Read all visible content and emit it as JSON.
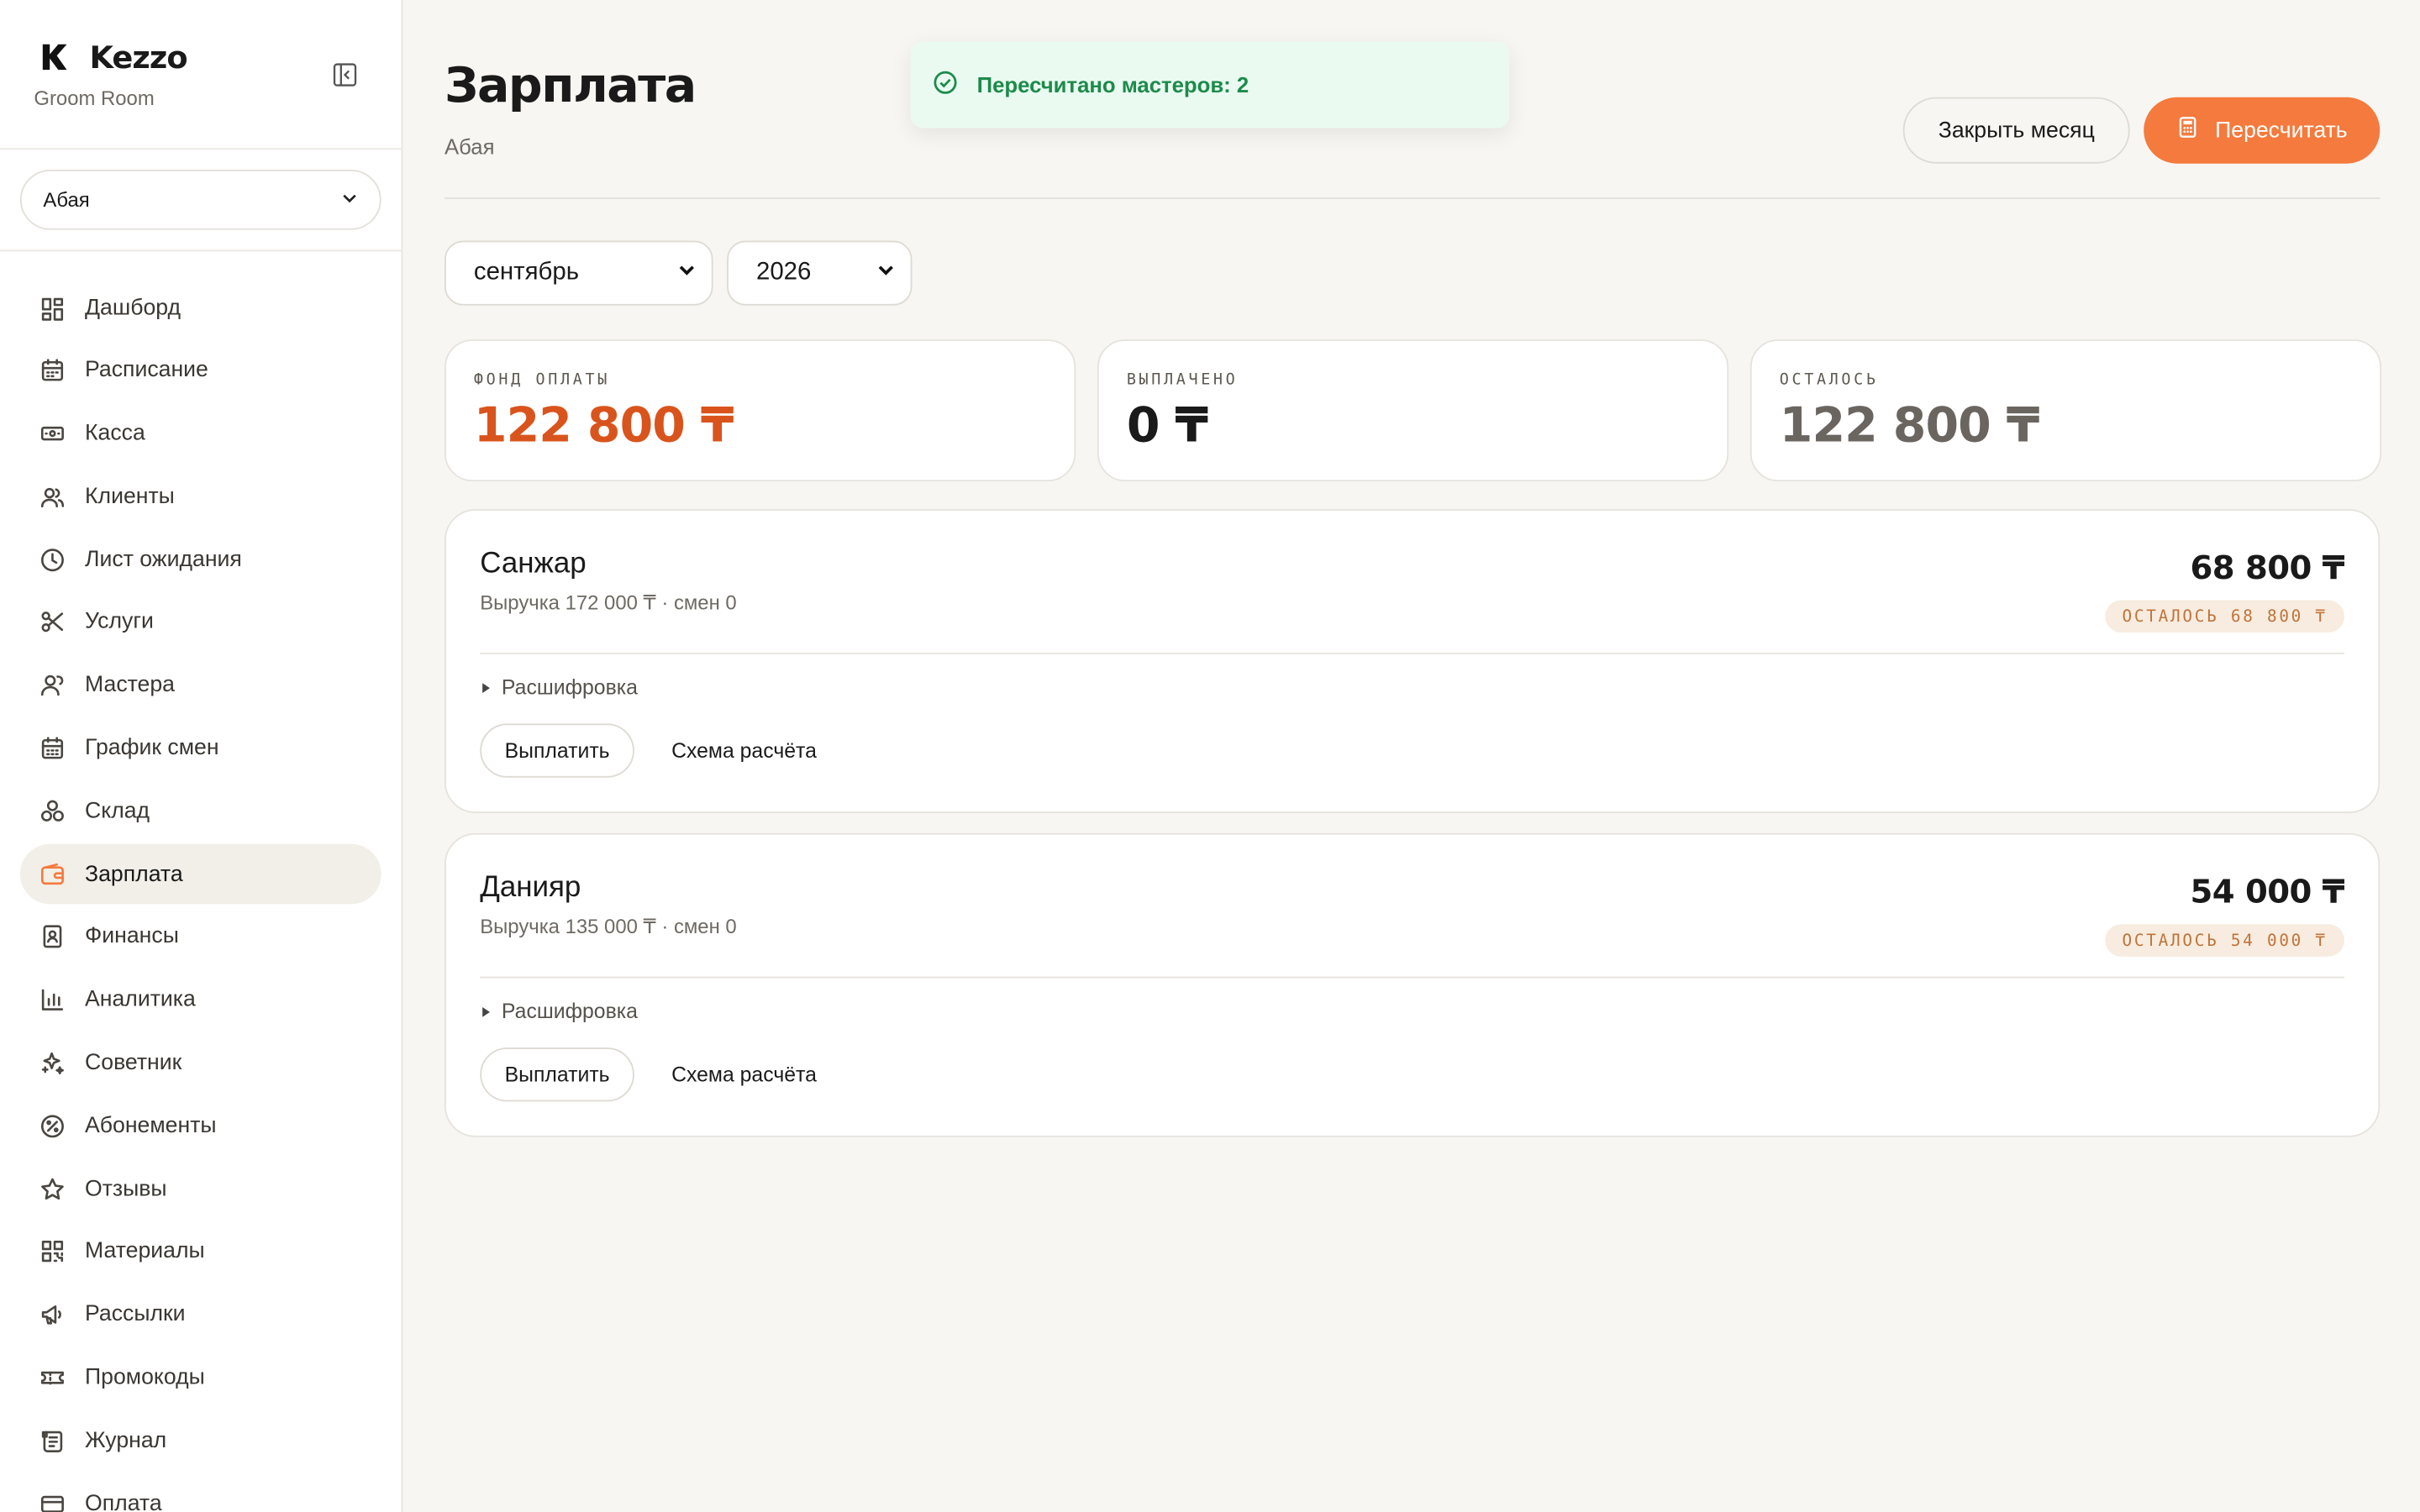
{
  "brand": {
    "name": "Kezzo",
    "subtitle": "Groom Room"
  },
  "branch_select": {
    "value": "Абая"
  },
  "nav": [
    {
      "label": "Дашборд",
      "icon": "dashboard-icon"
    },
    {
      "label": "Расписание",
      "icon": "calendar-icon"
    },
    {
      "label": "Касса",
      "icon": "cash-icon"
    },
    {
      "label": "Клиенты",
      "icon": "users-icon"
    },
    {
      "label": "Лист ожидания",
      "icon": "clock-icon"
    },
    {
      "label": "Услуги",
      "icon": "scissors-icon"
    },
    {
      "label": "Мастера",
      "icon": "masters-icon"
    },
    {
      "label": "График смен",
      "icon": "calendar-grid-icon"
    },
    {
      "label": "Склад",
      "icon": "boxes-icon"
    },
    {
      "label": "Зарплата",
      "icon": "wallet-icon",
      "active": true
    },
    {
      "label": "Финансы",
      "icon": "contact-book-icon"
    },
    {
      "label": "Аналитика",
      "icon": "bar-chart-icon"
    },
    {
      "label": "Советник",
      "icon": "sparkles-icon"
    },
    {
      "label": "Абонементы",
      "icon": "badge-percent-icon"
    },
    {
      "label": "Отзывы",
      "icon": "star-icon"
    },
    {
      "label": "Материалы",
      "icon": "qr-code-icon"
    },
    {
      "label": "Рассылки",
      "icon": "megaphone-icon"
    },
    {
      "label": "Промокоды",
      "icon": "ticket-icon"
    },
    {
      "label": "Журнал",
      "icon": "scroll-icon"
    },
    {
      "label": "Оплата",
      "icon": "card-icon"
    }
  ],
  "header": {
    "title": "Зарплата",
    "subtitle": "Абая",
    "close_month_label": "Закрыть месяц",
    "recalc_label": "Пересчитать"
  },
  "toast": {
    "text": "Пересчитано мастеров: 2"
  },
  "filters": {
    "month": "сентябрь",
    "year": "2026"
  },
  "stats": [
    {
      "label": "ФОНД ОПЛАТЫ",
      "value": "122 800 ₸",
      "color": "#d9541c"
    },
    {
      "label": "ВЫПЛАЧЕНО",
      "value": "0 ₸",
      "color": "#1a1a1a"
    },
    {
      "label": "ОСТАЛОСЬ",
      "value": "122 800 ₸",
      "color": "#6b6560"
    }
  ],
  "masters": [
    {
      "name": "Санжар",
      "meta": "Выручка 172 000 ₸ · смен 0",
      "amount": "68 800 ₸",
      "badge": "ОСТАЛОСЬ 68 800 ₸",
      "details_label": "Расшифровка",
      "pay_label": "Выплатить",
      "scheme_label": "Схема расчёта"
    },
    {
      "name": "Данияр",
      "meta": "Выручка 135 000 ₸ · смен 0",
      "amount": "54 000 ₸",
      "badge": "ОСТАЛОСЬ 54 000 ₸",
      "details_label": "Расшифровка",
      "pay_label": "Выплатить",
      "scheme_label": "Схема расчёта"
    }
  ],
  "colors": {
    "accent": "#f57a3d",
    "toast_bg": "#eafaf1",
    "toast_text": "#1c8b4a",
    "badge_bg": "#f7ecdf",
    "badge_text": "#c0733a"
  }
}
